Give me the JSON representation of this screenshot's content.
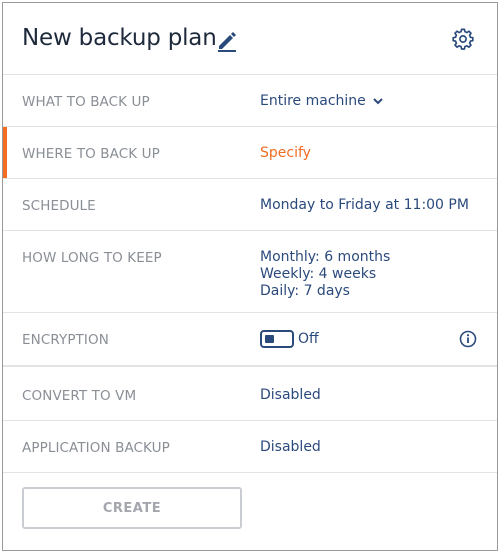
{
  "header": {
    "title": "New backup plan",
    "edit_icon": "pencil-icon",
    "settings_icon": "gear-icon"
  },
  "rows": {
    "what": {
      "label": "WHAT TO BACK UP",
      "value": "Entire machine",
      "icon": "chevron-down-icon"
    },
    "where": {
      "label": "WHERE TO BACK UP",
      "value": "Specify"
    },
    "schedule": {
      "label": "SCHEDULE",
      "value": "Monday to Friday at 11:00 PM"
    },
    "retention": {
      "label": "HOW LONG TO KEEP",
      "monthly": "Monthly: 6 months",
      "weekly": "Weekly: 4 weeks",
      "daily": "Daily: 7 days"
    },
    "encryption": {
      "label": "ENCRYPTION",
      "state": "Off",
      "toggle_on": false,
      "info_icon": "info-icon"
    },
    "convert": {
      "label": "CONVERT TO VM",
      "value": "Disabled"
    },
    "app_backup": {
      "label": "APPLICATION BACKUP",
      "value": "Disabled"
    }
  },
  "footer": {
    "create_label": "CREATE"
  },
  "colors": {
    "accent": "#f26d21",
    "link": "#2b4a7c",
    "label": "#8a8f96",
    "title": "#1e2a3c"
  }
}
